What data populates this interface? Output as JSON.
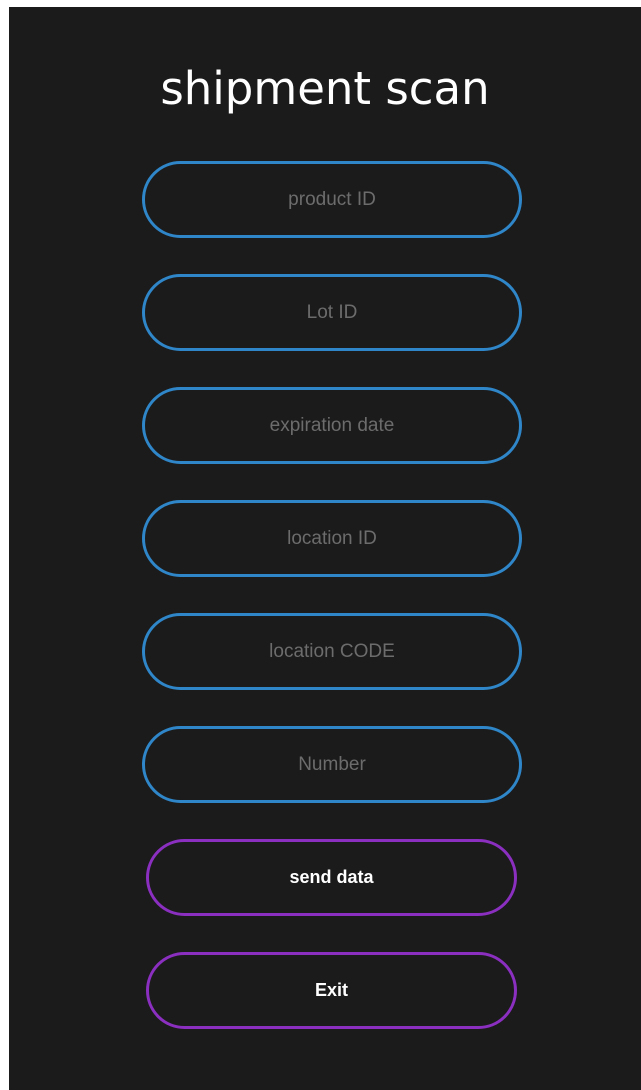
{
  "title": "shipment scan",
  "fields": {
    "product_id": {
      "value": "",
      "placeholder": "product ID"
    },
    "lot_id": {
      "value": "",
      "placeholder": "Lot ID"
    },
    "expiration_date": {
      "value": "",
      "placeholder": "expiration date"
    },
    "location_id": {
      "value": "",
      "placeholder": "location ID"
    },
    "location_code": {
      "value": "",
      "placeholder": "location CODE"
    },
    "number": {
      "value": "",
      "placeholder": "Number"
    }
  },
  "buttons": {
    "send_label": "send data",
    "exit_label": "Exit"
  },
  "colors": {
    "background": "#1b1b1b",
    "field_border": "#2f86c8",
    "button_border": "#8a2fc0",
    "title_text": "#ffffff",
    "placeholder_text": "#6c6c6c"
  }
}
